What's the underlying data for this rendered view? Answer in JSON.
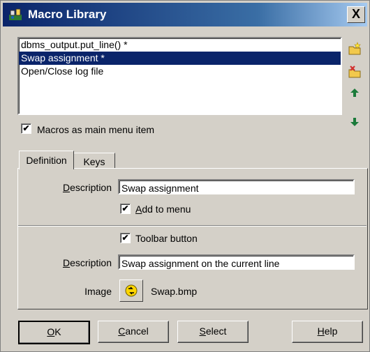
{
  "window": {
    "title": "Macro Library",
    "close_label": "X"
  },
  "macros": {
    "items": [
      "dbms_output.put_line() *",
      "Swap assignment *",
      "Open/Close log file"
    ],
    "selected_index": 1
  },
  "side_buttons": [
    "new-macro-icon",
    "delete-macro-icon",
    "move-up-icon",
    "move-down-icon"
  ],
  "macros_as_main_menu": {
    "label": "Macros as main menu item",
    "checked": true
  },
  "tabs": [
    {
      "label": "Definition",
      "active": true
    },
    {
      "label": "Keys",
      "active": false
    }
  ],
  "definition": {
    "description_label_first": "D",
    "description_label_rest": "escription",
    "description_value": "Swap assignment",
    "add_to_menu_first": "A",
    "add_to_menu_rest": "dd to menu",
    "add_to_menu_checked": true,
    "toolbar_button_label": "Toolbar button",
    "toolbar_button_checked": true,
    "toolbar_description_label_first": "D",
    "toolbar_description_label_rest": "escription",
    "toolbar_description_value": "Swap assignment on the current line",
    "image_label": "Image",
    "image_file": "Swap.bmp"
  },
  "buttons": {
    "ok_first": "O",
    "ok_rest": "K",
    "cancel_first": "C",
    "cancel_rest": "ancel",
    "select_first": "S",
    "select_rest": "elect",
    "help_first": "H",
    "help_rest": "elp"
  },
  "colors": {
    "selection": "#0a246a",
    "face": "#d4d0c8",
    "title_start": "#0a246a",
    "title_end": "#a6caf0"
  }
}
